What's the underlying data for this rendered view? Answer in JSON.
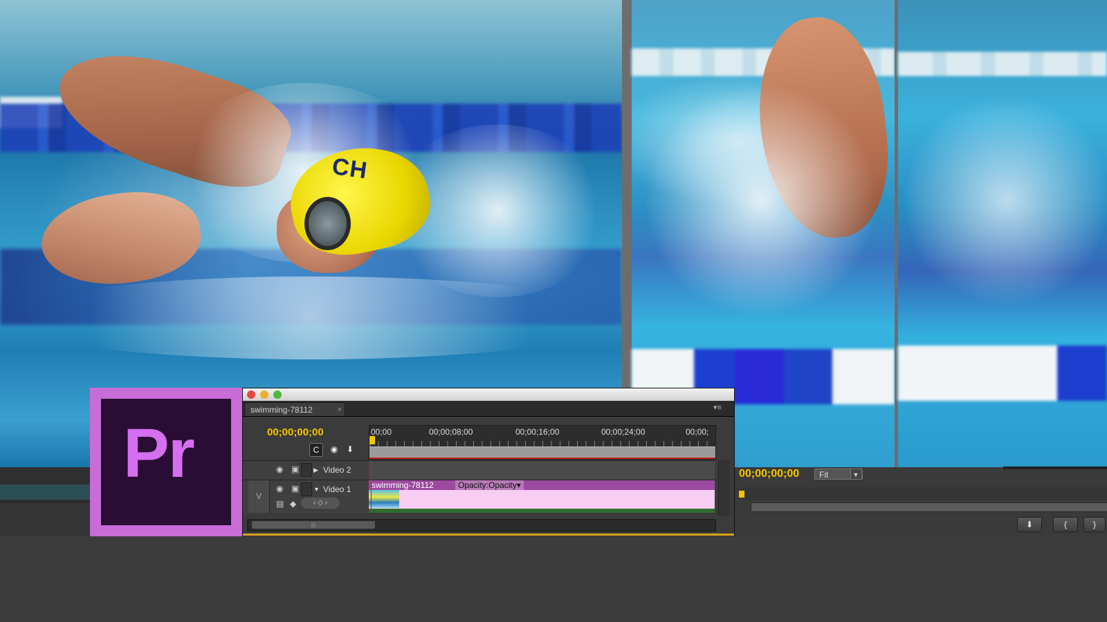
{
  "colors": {
    "accent_timecode": "#f5c400",
    "pr_logo_border": "#c86dd7",
    "pr_logo_bg": "#2a0d35",
    "pr_logo_text": "#d56ff0",
    "clip_header": "#9b4a9f",
    "clip_body": "#f8cdf3"
  },
  "background": {
    "main_photo": {
      "cap_text": "CH"
    }
  },
  "logo": {
    "text": "Pr"
  },
  "timeline": {
    "tab_label": "swimming-78112",
    "tab_close": "×",
    "panel_menu": "▾≡",
    "timecode": "00;00;00;00",
    "ruler_labels": [
      "00;00",
      "00;00;08;00",
      "00;00;16;00",
      "00;00;24;00",
      "00;00;"
    ],
    "tracks": {
      "video2": {
        "name": "Video 2"
      },
      "video1": {
        "name": "Video 1",
        "badge": "V"
      }
    },
    "clip": {
      "name": "swimming-78112",
      "opacity_menu": "Opacity:Opacity▾"
    }
  },
  "program_monitor": {
    "timecode": "00;00;00;00",
    "zoom": "Fit",
    "buttons": [
      "⬇",
      "{",
      "}"
    ]
  },
  "icons": [
    "snap-icon",
    "marker-icon",
    "eye-icon",
    "film-icon",
    "keyframe-icon"
  ]
}
